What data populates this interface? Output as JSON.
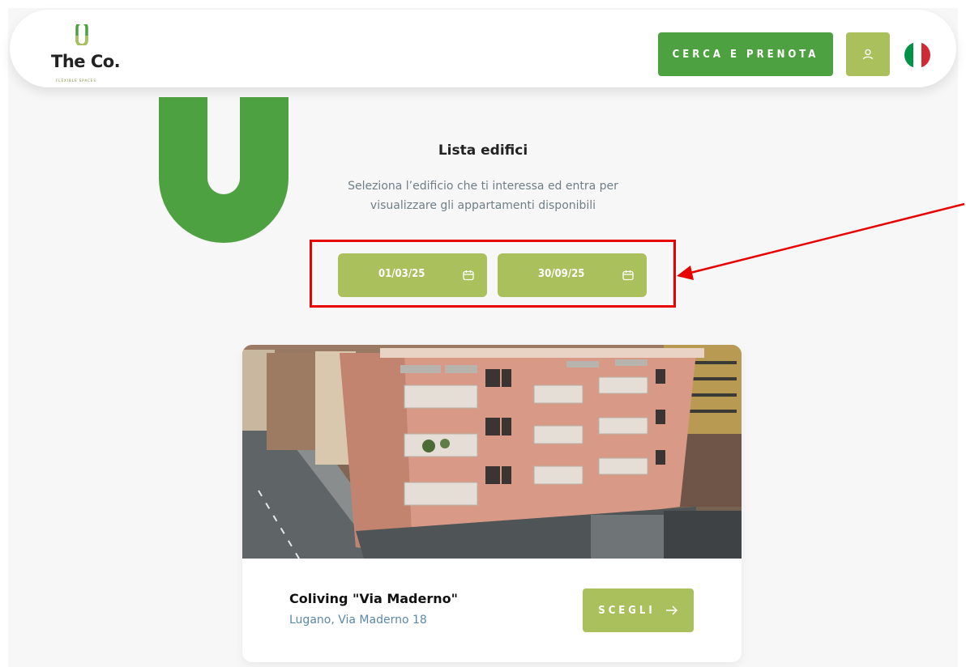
{
  "brand": {
    "name": "The Co.",
    "tagline": "FLEXIBLE SPACES",
    "primary_color": "#4ea140",
    "accent_color": "#a9c05d"
  },
  "header": {
    "cta_label": "CERCA E PRENOTA",
    "user_icon": "user-icon",
    "language_flag": "italy-flag-icon"
  },
  "main": {
    "title": "Lista edifici",
    "subtitle": "Seleziona l’edificio che ti interessa ed entra per visualizzare gli appartamenti disponibili",
    "dates": {
      "start": "01/03/25",
      "end": "30/09/25",
      "icon": "calendar-icon"
    }
  },
  "annotation": {
    "highlight_color": "#e60000"
  },
  "building_card": {
    "name": "Coliving \"Via Maderno\"",
    "address": "Lugano, Via Maderno 18",
    "button_label": "SCEGLI",
    "button_icon": "arrow-right-icon"
  }
}
